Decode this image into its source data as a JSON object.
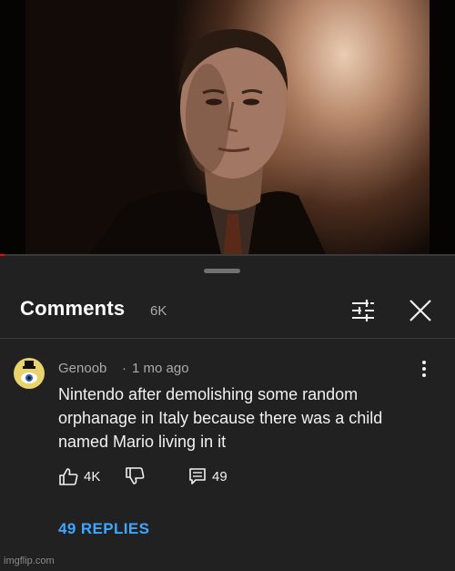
{
  "video": {
    "progress_fraction": 0.01,
    "accent_color": "#ff0000"
  },
  "comments": {
    "title": "Comments",
    "count": "6K",
    "filter_icon": "sort-filter-icon",
    "close_icon": "close-icon"
  },
  "comment": {
    "author": "Genoob",
    "separator": "·",
    "time": "1 mo ago",
    "text": "Nintendo after demolishing some random orphanage in Italy because there was a child named Mario living in it",
    "likes": "4K",
    "replies_count": "49",
    "replies_link": "49 REPLIES"
  },
  "colors": {
    "background": "#212121",
    "link": "#3ea6ff",
    "secondary_text": "#aaaaaa"
  },
  "watermark": "imgflip.com"
}
